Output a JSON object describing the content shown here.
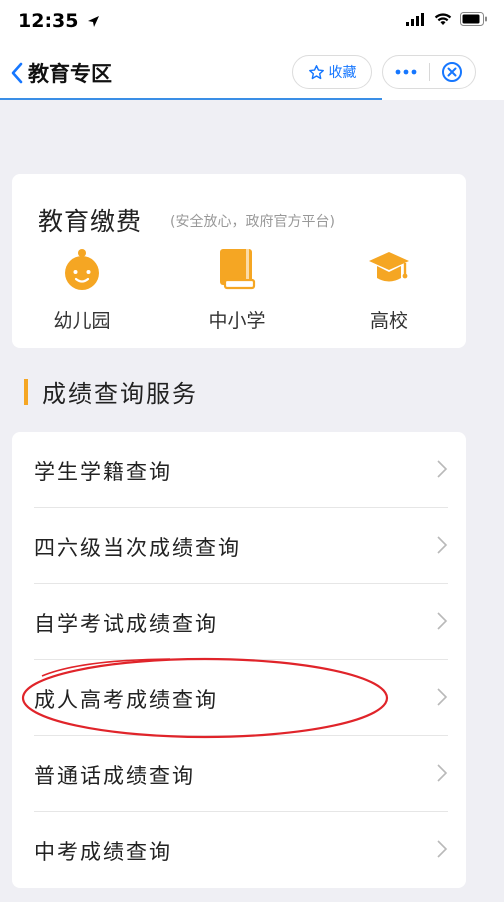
{
  "status": {
    "time": "12:35"
  },
  "nav": {
    "title": "教育专区",
    "favorite_label": "收藏"
  },
  "pay": {
    "title": "教育缴费",
    "subtitle": "(安全放心，政府官方平台)",
    "items": [
      {
        "label": "幼儿园",
        "icon": "baby-face-icon"
      },
      {
        "label": "中小学",
        "icon": "book-icon"
      },
      {
        "label": "高校",
        "icon": "graduation-cap-icon"
      }
    ]
  },
  "section": {
    "title": "成绩查询服务",
    "accent": "#f5a623"
  },
  "services": [
    {
      "label": "学生学籍查询"
    },
    {
      "label": "四六级当次成绩查询"
    },
    {
      "label": "自学考试成绩查询"
    },
    {
      "label": "成人高考成绩查询"
    },
    {
      "label": "普通话成绩查询"
    },
    {
      "label": "中考成绩查询"
    }
  ],
  "colors": {
    "accent_blue": "#1677ff",
    "icon_orange": "#f5a623",
    "annotation_red": "#e0242a"
  }
}
